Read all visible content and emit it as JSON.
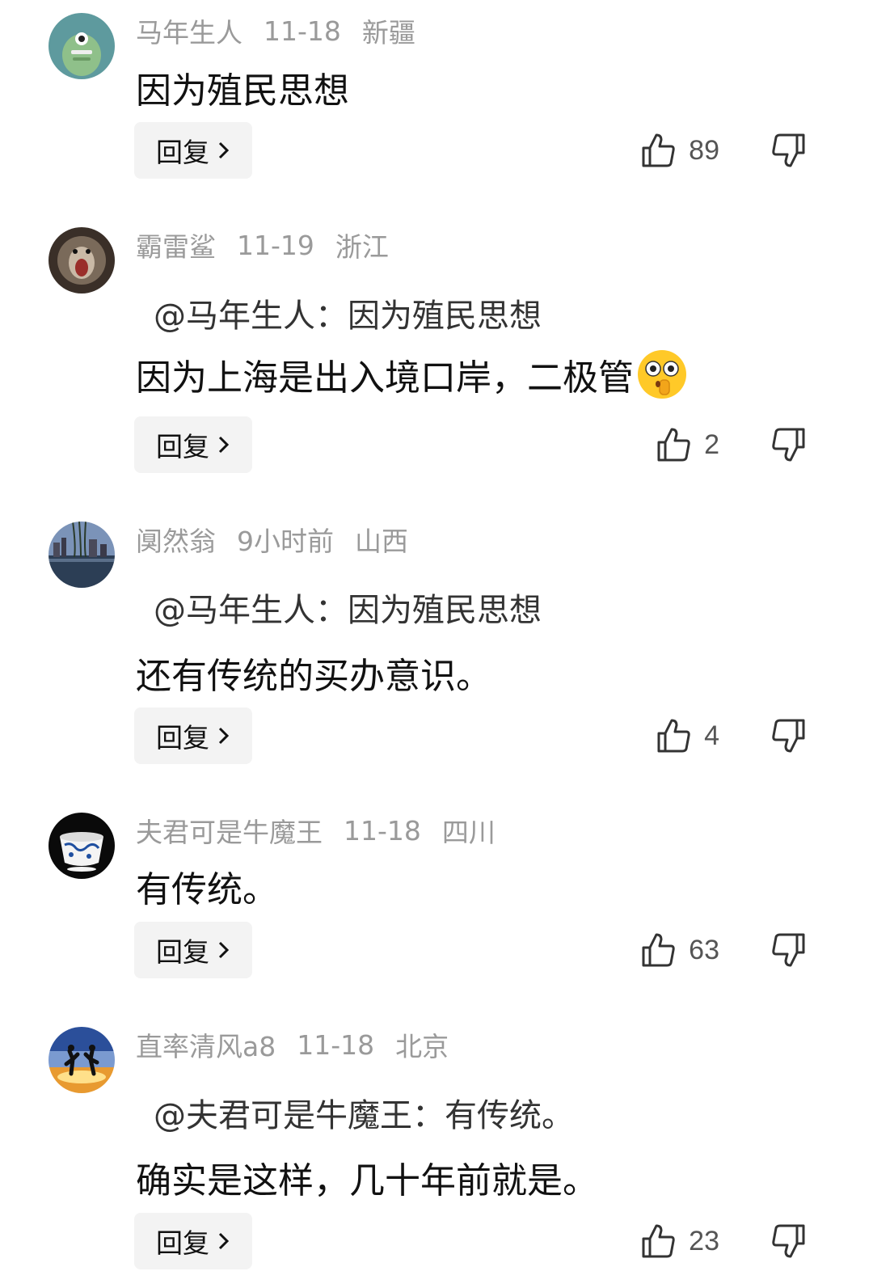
{
  "comments": [
    {
      "username": "马年生人",
      "date": "11-18",
      "location": "新疆",
      "quote": "",
      "text": "因为殖民思想",
      "reply_label": "回复",
      "likes": "89"
    },
    {
      "username": "霸雷鲨",
      "date": "11-19",
      "location": "浙江",
      "quote": "@马年生人：因为殖民思想",
      "text": "因为上海是出入境口岸，二极管",
      "reply_label": "回复",
      "likes": "2"
    },
    {
      "username": "阒然翁",
      "date": "9小时前",
      "location": "山西",
      "quote": "@马年生人：因为殖民思想",
      "text": "还有传统的买办意识。",
      "reply_label": "回复",
      "likes": "4"
    },
    {
      "username": "夫君可是牛魔王",
      "date": "11-18",
      "location": "四川",
      "quote": "",
      "text": "有传统。",
      "reply_label": "回复",
      "likes": "63"
    },
    {
      "username": "直率清风a8",
      "date": "11-18",
      "location": "北京",
      "quote": "@夫君可是牛魔王：有传统。",
      "text": "确实是这样，几十年前就是。",
      "reply_label": "回复",
      "likes": "23"
    }
  ],
  "icons": {
    "like": "thumbs-up-icon",
    "dislike": "thumbs-down-icon",
    "chevron": "chevron-right-icon",
    "emoji": "shocked-emoji-icon"
  }
}
